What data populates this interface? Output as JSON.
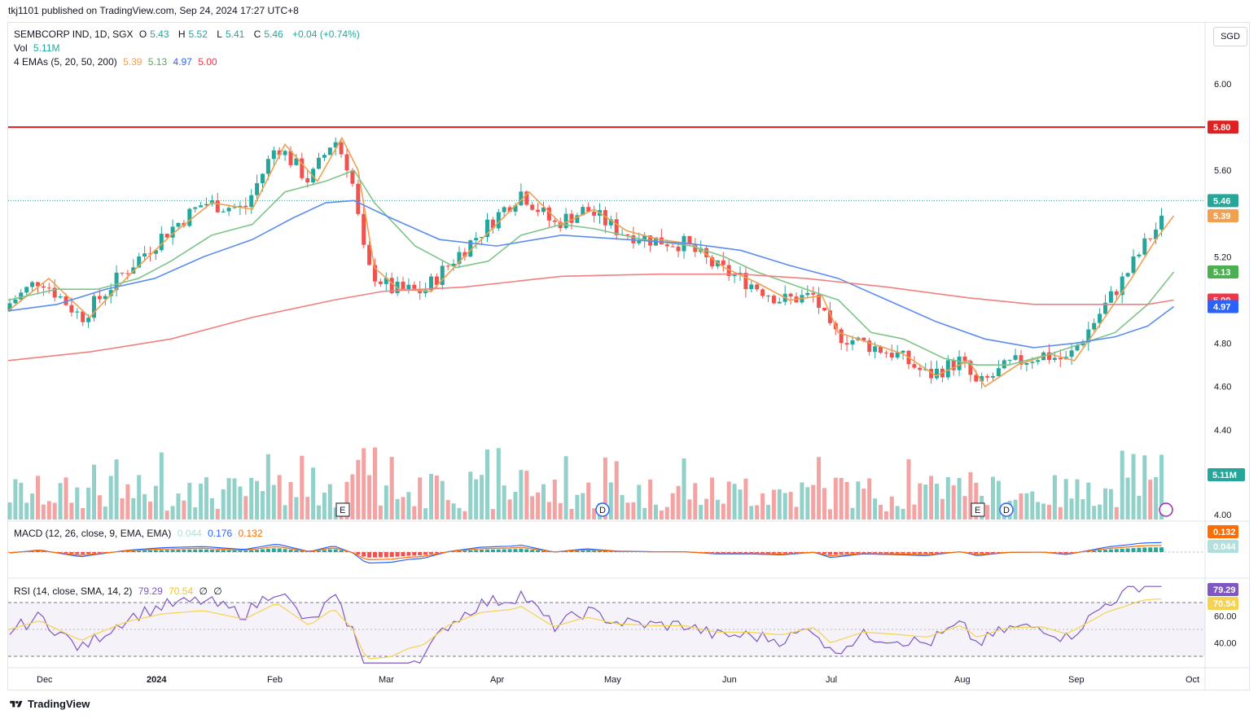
{
  "header": {
    "published": "tkj1101 published on TradingView.com, Sep 24, 2024 17:27 UTC+8"
  },
  "currency_button": "SGD",
  "legend": {
    "symbol": "SEMBCORP IND, 1D, SGX",
    "o_label": "O",
    "o": "5.43",
    "h_label": "H",
    "h": "5.52",
    "l_label": "L",
    "l": "5.41",
    "c_label": "C",
    "c": "5.46",
    "change": "+0.04 (+0.74%)",
    "vol_label": "Vol",
    "vol": "5.11M",
    "ema_label": "4 EMAs (5, 20, 50, 200)",
    "ema5": "5.39",
    "ema20": "5.13",
    "ema50": "4.97",
    "ema200": "5.00",
    "macd_label": "MACD (12, 26, close, 9, EMA, EMA)",
    "macd_hist": "0.044",
    "macd_line": "0.176",
    "macd_signal": "0.132",
    "rsi_label": "RSI (14, close, SMA, 14, 2)",
    "rsi": "79.29",
    "rsi_ma": "70.54",
    "rsi_x": "∅",
    "rsi_y": "∅"
  },
  "colors": {
    "up": "#26a69a",
    "down": "#ef5350",
    "ema5": "#f0a050",
    "ema20": "#7fc48a",
    "ema50": "#5b8def",
    "ema200": "#f08080",
    "resistance": "#e02020",
    "macd": "#2962ff",
    "signal": "#ff6d00",
    "rsi": "#7e57c2",
    "rsi_ma": "#f5d34e"
  },
  "footer": {
    "brand": "TradingView"
  },
  "chart_data": {
    "type": "candlestick",
    "title": "SEMBCORP IND, 1D, SGX",
    "price_axis": {
      "ticks": [
        "6.00",
        "5.80",
        "5.60",
        "5.40",
        "5.20",
        "5.00",
        "4.80",
        "4.60",
        "4.40",
        "4.00"
      ],
      "range": [
        4.0,
        6.2
      ]
    },
    "time_axis": {
      "labels": [
        "Dec",
        "2024",
        "Feb",
        "Mar",
        "Apr",
        "May",
        "Jun",
        "Jul",
        "Aug",
        "Sep",
        "Oct"
      ]
    },
    "resistance_level": 5.8,
    "last_price": 5.46,
    "price_tags": [
      {
        "value": "5.80",
        "color": "#e02020"
      },
      {
        "value": "5.46",
        "color": "#26a69a"
      },
      {
        "value": "5.39",
        "color": "#f0a050"
      },
      {
        "value": "5.13",
        "color": "#4caf50"
      },
      {
        "value": "5.00",
        "color": "#f23645"
      },
      {
        "value": "4.97",
        "color": "#2962ff"
      }
    ],
    "volume_tag": "5.11M",
    "event_markers": [
      {
        "label": "E",
        "date": "Feb 20"
      },
      {
        "label": "D",
        "date": "Apr 29"
      },
      {
        "label": "E",
        "date": "Aug 5"
      },
      {
        "label": "D",
        "date": "Aug 8"
      }
    ],
    "macd_tags": [
      "0.132",
      "0.044"
    ],
    "rsi_axis": {
      "ticks": [
        "60.00",
        "40.00"
      ],
      "range": [
        20,
        90
      ],
      "upper": 70,
      "lower": 30
    },
    "rsi_tags": [
      "79.29",
      "70.54"
    ],
    "series": [
      {
        "name": "EMA 5",
        "points": [
          [
            0,
            4.95
          ],
          [
            50,
            5.1
          ],
          [
            100,
            4.92
          ],
          [
            150,
            5.12
          ],
          [
            200,
            5.3
          ],
          [
            250,
            5.45
          ],
          [
            300,
            5.42
          ],
          [
            340,
            5.72
          ],
          [
            380,
            5.55
          ],
          [
            410,
            5.75
          ],
          [
            430,
            5.6
          ],
          [
            450,
            5.15
          ],
          [
            480,
            5.05
          ],
          [
            520,
            5.04
          ],
          [
            560,
            5.2
          ],
          [
            600,
            5.35
          ],
          [
            640,
            5.5
          ],
          [
            680,
            5.35
          ],
          [
            720,
            5.42
          ],
          [
            760,
            5.32
          ],
          [
            800,
            5.28
          ],
          [
            840,
            5.26
          ],
          [
            880,
            5.15
          ],
          [
            920,
            5.08
          ],
          [
            960,
            5.0
          ],
          [
            1000,
            5.02
          ],
          [
            1020,
            4.85
          ],
          [
            1060,
            4.8
          ],
          [
            1100,
            4.75
          ],
          [
            1140,
            4.65
          ],
          [
            1180,
            4.72
          ],
          [
            1200,
            4.6
          ],
          [
            1240,
            4.7
          ],
          [
            1280,
            4.75
          ],
          [
            1310,
            4.72
          ],
          [
            1340,
            4.88
          ],
          [
            1380,
            5.1
          ],
          [
            1410,
            5.28
          ],
          [
            1432,
            5.39
          ]
        ]
      },
      {
        "name": "EMA 20",
        "points": [
          [
            0,
            5.0
          ],
          [
            60,
            5.05
          ],
          [
            110,
            5.05
          ],
          [
            160,
            5.1
          ],
          [
            200,
            5.18
          ],
          [
            250,
            5.3
          ],
          [
            300,
            5.35
          ],
          [
            340,
            5.5
          ],
          [
            390,
            5.55
          ],
          [
            425,
            5.6
          ],
          [
            450,
            5.45
          ],
          [
            500,
            5.25
          ],
          [
            550,
            5.15
          ],
          [
            590,
            5.18
          ],
          [
            630,
            5.3
          ],
          [
            680,
            5.35
          ],
          [
            720,
            5.33
          ],
          [
            780,
            5.28
          ],
          [
            840,
            5.25
          ],
          [
            880,
            5.2
          ],
          [
            920,
            5.13
          ],
          [
            980,
            5.05
          ],
          [
            1020,
            5.0
          ],
          [
            1060,
            4.85
          ],
          [
            1100,
            4.82
          ],
          [
            1150,
            4.73
          ],
          [
            1190,
            4.7
          ],
          [
            1230,
            4.7
          ],
          [
            1280,
            4.75
          ],
          [
            1320,
            4.8
          ],
          [
            1360,
            4.85
          ],
          [
            1400,
            4.98
          ],
          [
            1432,
            5.13
          ]
        ]
      },
      {
        "name": "EMA 50",
        "points": [
          [
            0,
            4.95
          ],
          [
            60,
            4.98
          ],
          [
            120,
            5.05
          ],
          [
            180,
            5.1
          ],
          [
            240,
            5.2
          ],
          [
            300,
            5.28
          ],
          [
            350,
            5.38
          ],
          [
            390,
            5.45
          ],
          [
            425,
            5.46
          ],
          [
            470,
            5.38
          ],
          [
            530,
            5.28
          ],
          [
            600,
            5.25
          ],
          [
            680,
            5.3
          ],
          [
            760,
            5.28
          ],
          [
            840,
            5.26
          ],
          [
            900,
            5.23
          ],
          [
            960,
            5.16
          ],
          [
            1020,
            5.1
          ],
          [
            1080,
            5.0
          ],
          [
            1140,
            4.9
          ],
          [
            1200,
            4.82
          ],
          [
            1260,
            4.78
          ],
          [
            1310,
            4.8
          ],
          [
            1360,
            4.83
          ],
          [
            1400,
            4.88
          ],
          [
            1432,
            4.97
          ]
        ]
      },
      {
        "name": "EMA 200",
        "points": [
          [
            0,
            4.72
          ],
          [
            100,
            4.76
          ],
          [
            200,
            4.82
          ],
          [
            300,
            4.92
          ],
          [
            400,
            5.0
          ],
          [
            460,
            5.04
          ],
          [
            560,
            5.06
          ],
          [
            680,
            5.11
          ],
          [
            800,
            5.12
          ],
          [
            900,
            5.12
          ],
          [
            980,
            5.1
          ],
          [
            1080,
            5.06
          ],
          [
            1180,
            5.01
          ],
          [
            1260,
            4.98
          ],
          [
            1340,
            4.98
          ],
          [
            1400,
            4.98
          ],
          [
            1432,
            5.0
          ]
        ]
      }
    ]
  }
}
